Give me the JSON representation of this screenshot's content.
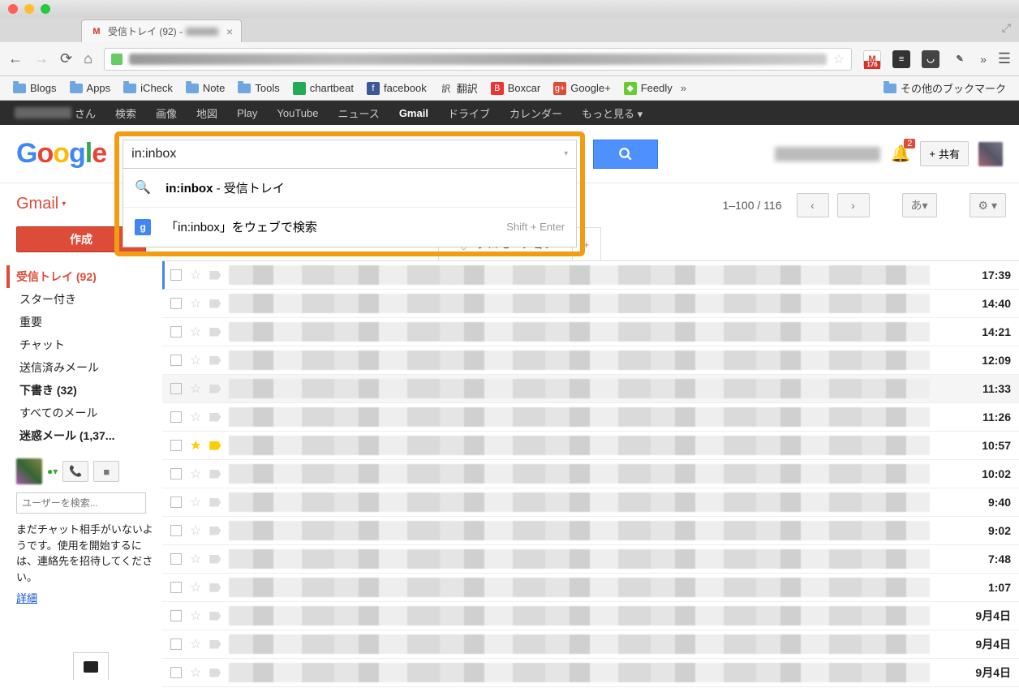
{
  "window": {
    "tabTitle": "受信トレイ (92) -"
  },
  "bookmarks": {
    "items": [
      "Blogs",
      "Apps",
      "iCheck",
      "Note",
      "Tools",
      "chartbeat",
      "facebook",
      "翻訳",
      "Boxcar",
      "Google+",
      "Feedly"
    ],
    "more": "»",
    "other": "その他のブックマーク"
  },
  "gbar": {
    "suffix": "さん",
    "links": [
      "検索",
      "画像",
      "地図",
      "Play",
      "YouTube",
      "ニュース",
      "Gmail",
      "ドライブ",
      "カレンダー",
      "もっと見る ▾"
    ],
    "activeIndex": 6
  },
  "extBadge": "176",
  "search": {
    "value": "in:inbox",
    "suggest1_prefix": "in:inbox",
    "suggest1_rest": " - 受信トレイ",
    "suggest2": "「in:inbox」をウェブで検索",
    "suggest2_hint": "Shift + Enter"
  },
  "header": {
    "notif": "2",
    "share": "共有"
  },
  "toolbar": {
    "pager": "1–100 / 116",
    "lang": "あ"
  },
  "sidebar": {
    "gmail": "Gmail",
    "compose": "作成",
    "items": [
      {
        "label": "受信トレイ (92)",
        "sel": true,
        "bold": true
      },
      {
        "label": "スター付き"
      },
      {
        "label": "重要"
      },
      {
        "label": "チャット"
      },
      {
        "label": "送信済みメール"
      },
      {
        "label": "下書き (32)",
        "bold": true
      },
      {
        "label": "すべてのメール"
      },
      {
        "label": "迷惑メール (1,37...",
        "bold": true
      }
    ],
    "searchPlaceholder": "ユーザーを検索...",
    "hangoutText": "まだチャット相手がいないようです。使用を開始するには、連絡先を招待してください。",
    "detail": "詳細"
  },
  "tabs": {
    "promo": "プロモーション"
  },
  "rows": [
    {
      "time": "17:39",
      "sel": true
    },
    {
      "time": "14:40"
    },
    {
      "time": "14:21"
    },
    {
      "time": "12:09"
    },
    {
      "time": "11:33",
      "unread": true
    },
    {
      "time": "11:26"
    },
    {
      "time": "10:57",
      "star": true,
      "impY": true
    },
    {
      "time": "10:02"
    },
    {
      "time": "9:40"
    },
    {
      "time": "9:02"
    },
    {
      "time": "7:48"
    },
    {
      "time": "1:07"
    },
    {
      "time": "9月4日"
    },
    {
      "time": "9月4日"
    },
    {
      "time": "9月4日"
    }
  ]
}
